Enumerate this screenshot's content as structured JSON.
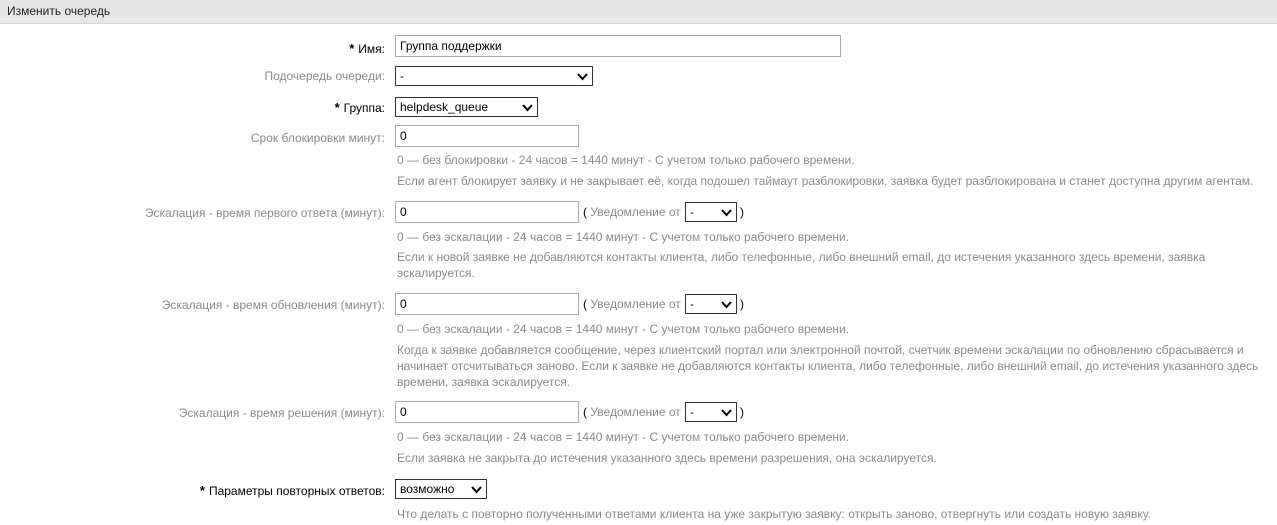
{
  "header": {
    "title": "Изменить очередь"
  },
  "form": {
    "name": {
      "label": "Имя:",
      "value": "Группа поддержки"
    },
    "subqueue": {
      "label": "Подочередь очереди:",
      "value": "-"
    },
    "group": {
      "label": "Группа:",
      "value": "helpdesk_queue"
    },
    "unlock": {
      "label": "Срок блокировки минут:",
      "value": "0",
      "hint1": "0 — без блокировки - 24 часов = 1440 минут - С учетом только рабочего времени.",
      "hint2": "Если агент блокирует заявку и не закрывает её, когда подошел таймаут разблокировки, заявка будет разблокирована и станет доступна другим агентам."
    },
    "first_response": {
      "label": "Эскалация - время первого ответа (минут):",
      "value": "0",
      "notify_label": "Уведомление от",
      "notify_value": "-",
      "hint1": "0 — без эскалации - 24 часов = 1440 минут - С учетом только рабочего времени.",
      "hint2": "Если к новой заявке не добавляются контакты клиента, либо телефонные, либо внешний email, до истечения указанного здесь времени, заявка эскалируется."
    },
    "update": {
      "label": "Эскалация - время обновления (минут):",
      "value": "0",
      "notify_label": "Уведомление от",
      "notify_value": "-",
      "hint1": "0 — без эскалации - 24 часов = 1440 минут - С учетом только рабочего времени.",
      "hint2": "Когда к заявке добавляется сообщение, через клиентский портал или электронной почтой, счетчик времени эскалации по обновлению сбрасывается и начинает отсчитываться заново. Если к заявке не добавляются контакты клиента, либо телефонные, либо внешний email, до истечения указанного здесь времени, заявка эскалируется."
    },
    "solution": {
      "label": "Эскалация - время решения (минут):",
      "value": "0",
      "notify_label": "Уведомление от",
      "notify_value": "-",
      "hint1": "0 — без эскалации - 24 часов = 1440 минут - С учетом только рабочего времени.",
      "hint2": "Если заявка не закрыта до истечения указанного здесь времени разрешения, она эскалируется."
    },
    "follow_up": {
      "label": "Параметры повторных ответов:",
      "value": "возможно",
      "hint1": "Что делать с повторно полученными ответами клиента на уже закрытую заявку: открыть заново, отвергнуть или создать новую заявку."
    }
  },
  "icons": {
    "required": "asterisk",
    "dropdown": "chevron-down-icon"
  },
  "colors": {
    "header_bg": "#e7e7e7",
    "muted_text": "#8a8a8a"
  }
}
